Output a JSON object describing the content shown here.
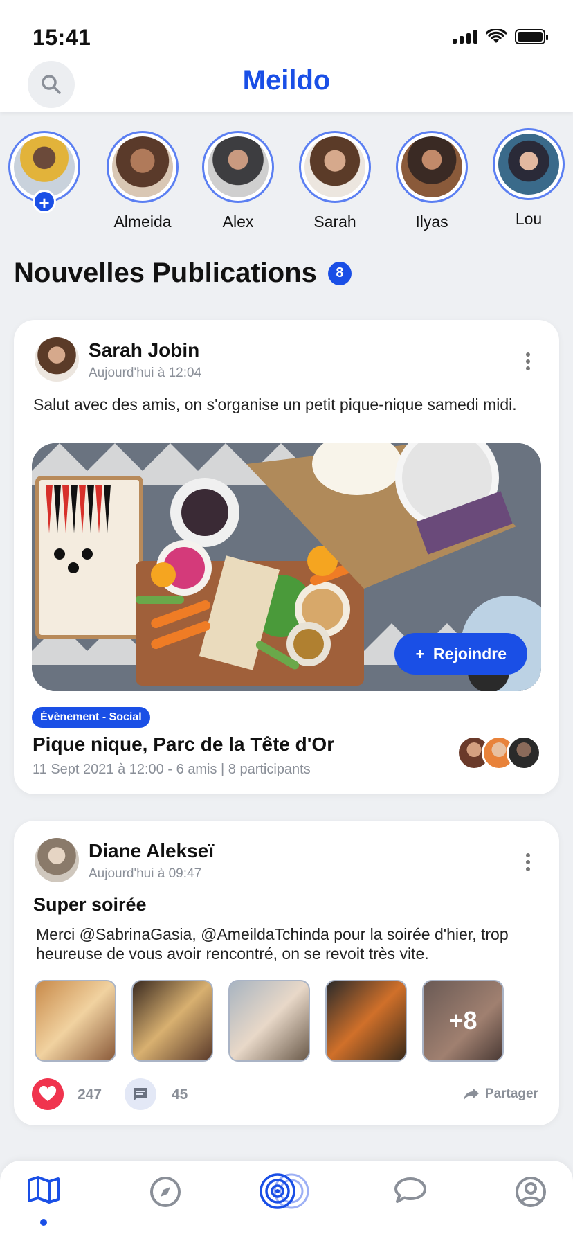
{
  "status_bar": {
    "time": "15:41"
  },
  "header": {
    "title": "Meildo",
    "search_icon": "search-icon"
  },
  "stories": [
    {
      "name": "",
      "is_self": true,
      "add_label": "+"
    },
    {
      "name": "Almeida"
    },
    {
      "name": "Alex"
    },
    {
      "name": "Sarah"
    },
    {
      "name": "Ilyas"
    },
    {
      "name": "Lou"
    }
  ],
  "feed": {
    "title": "Nouvelles Publications",
    "count": "8"
  },
  "post1": {
    "author": "Sarah Jobin",
    "time": "Aujourd'hui à 12:04",
    "text": "Salut avec des amis, on s'organise un petit pique-nique samedi midi.",
    "join_label": "Rejoindre",
    "join_icon": "+",
    "tag": "Évènement - Social",
    "event_title": "Pique nique, Parc de la Tête d'Or",
    "event_meta": "11 Sept 2021 à 12:00 - 6 amis | 8 participants"
  },
  "post2": {
    "author": "Diane Alekseï",
    "time": "Aujourd'hui à 09:47",
    "title": "Super soirée",
    "text": "Merci @SabrinaGasia, @AmeildaTchinda pour la soirée d'hier, trop heureuse de vous avoir rencontré, on se revoit très vite.",
    "more_photos": "+8",
    "likes": "247",
    "comments": "45",
    "share_label": "Partager"
  },
  "nav": [
    "map-icon",
    "compass-icon",
    "radar-icon",
    "chat-icon",
    "profile-icon"
  ],
  "colors": {
    "accent": "#1a4fe6",
    "like": "#f0344e",
    "background": "#eef0f3"
  }
}
